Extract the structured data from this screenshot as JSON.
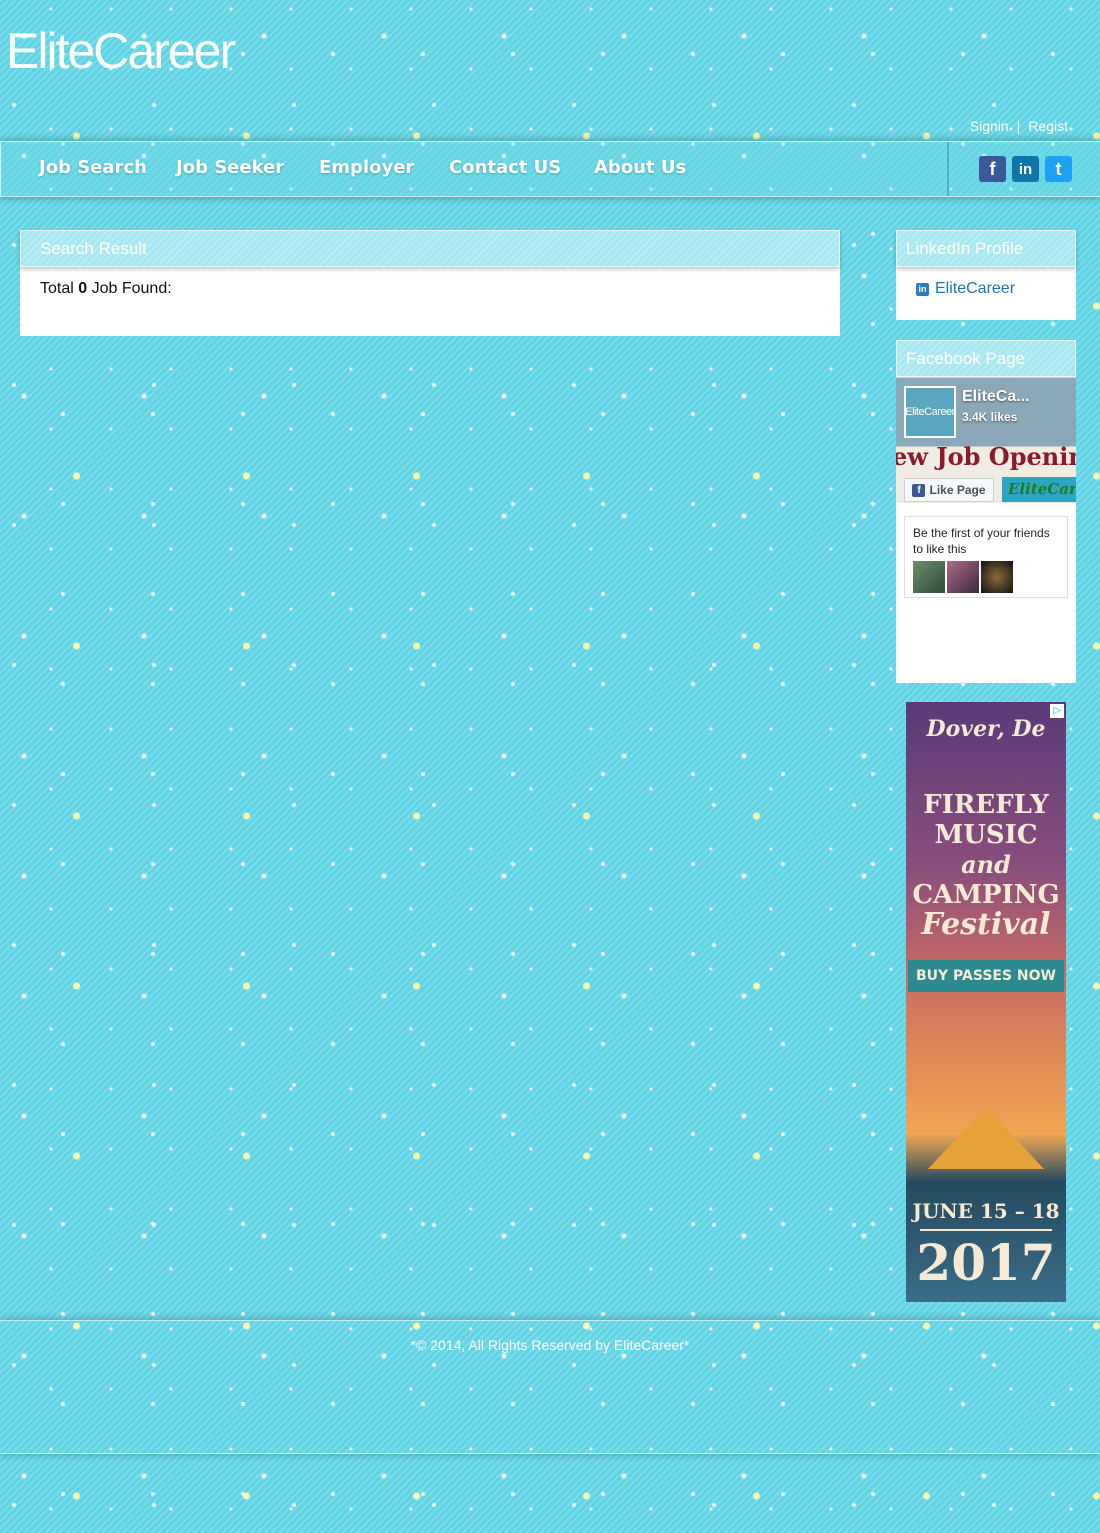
{
  "site": {
    "logo": "EliteCareer"
  },
  "account": {
    "signin": "Signin",
    "separator": "|",
    "register": "Regist"
  },
  "nav": {
    "items": [
      "Job Search",
      "Job Seeker",
      "Employer",
      "Contact US",
      "About Us"
    ]
  },
  "social": {
    "facebook": "f",
    "linkedin": "in",
    "twitter": "t"
  },
  "search_result": {
    "title": "Search Result",
    "total_prefix": "Total",
    "count": "0",
    "total_suffix": "Job Found:"
  },
  "linkedin_profile": {
    "title": "LinkedIn Profile",
    "link_text": "EliteCareer"
  },
  "facebook_page": {
    "title": "Facebook Page",
    "page_name": "EliteCa...",
    "thumb_text": "EliteCareer",
    "likes": "3.4K likes",
    "banner_text": "ew Job Openin",
    "like_button": "Like Page",
    "badge_text": "EliteCar",
    "friends_text": "Be the first of your friends to like this"
  },
  "ad": {
    "city": "Dover, De",
    "line1": "FIREFLY",
    "line2": "MUSIC",
    "line3": "and",
    "line4": "CAMPING",
    "line5": "Festival",
    "cta": "BUY PASSES NOW",
    "dates": "JUNE 15 – 18",
    "year": "2017"
  },
  "footer": {
    "copyright": "*© 2014, All Rights Reserved by EliteCareer*"
  },
  "colors": {
    "background": "#5fd4e4",
    "link": "#1f73b7",
    "facebook": "#3b5998",
    "linkedin": "#0e76a8",
    "twitter": "#1da1f2"
  }
}
